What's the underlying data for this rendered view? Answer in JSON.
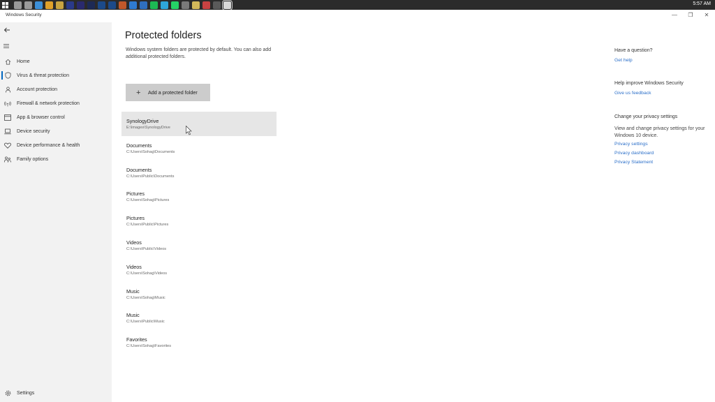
{
  "taskbar": {
    "clock": "5:57 AM",
    "icons": [
      "windows-start-icon",
      "search-icon",
      "task-view-icon",
      "edge-icon",
      "chrome-icon",
      "files-icon",
      "bridge-icon",
      "premiere-icon",
      "media-encoder-icon",
      "photoshop-icon",
      "lightroom-icon",
      "illustrator-icon",
      "mail-icon",
      "onedrive-icon",
      "spotify-icon",
      "telegram-icon",
      "whatsapp-icon",
      "app-icon",
      "notes-icon",
      "app-icon-2",
      "obs-icon",
      "windows-security-icon"
    ]
  },
  "window": {
    "title": "Windows Security",
    "minimize": "—",
    "restore": "❐",
    "close": "✕"
  },
  "sidebar": {
    "items": [
      {
        "label": "Home",
        "icon": "home-icon"
      },
      {
        "label": "Virus & threat protection",
        "icon": "shield-icon"
      },
      {
        "label": "Account protection",
        "icon": "person-icon"
      },
      {
        "label": "Firewall & network protection",
        "icon": "wifi-antenna-icon"
      },
      {
        "label": "App & browser control",
        "icon": "browser-window-icon"
      },
      {
        "label": "Device security",
        "icon": "laptop-icon"
      },
      {
        "label": "Device performance & health",
        "icon": "heart-icon"
      },
      {
        "label": "Family options",
        "icon": "family-icon"
      }
    ],
    "settings_label": "Settings"
  },
  "main": {
    "title": "Protected folders",
    "description": "Windows system folders are protected by default. You can also add additional protected folders.",
    "add_button": "Add a protected folder",
    "folders": [
      {
        "name": "SynologyDrive",
        "path": "E:\\Images\\SynologyDrive"
      },
      {
        "name": "Documents",
        "path": "C:\\Users\\Sohag\\Documents"
      },
      {
        "name": "Documents",
        "path": "C:\\Users\\Public\\Documents"
      },
      {
        "name": "Pictures",
        "path": "C:\\Users\\Sohag\\Pictures"
      },
      {
        "name": "Pictures",
        "path": "C:\\Users\\Public\\Pictures"
      },
      {
        "name": "Videos",
        "path": "C:\\Users\\Public\\Videos"
      },
      {
        "name": "Videos",
        "path": "C:\\Users\\Sohag\\Videos"
      },
      {
        "name": "Music",
        "path": "C:\\Users\\Sohag\\Music"
      },
      {
        "name": "Music",
        "path": "C:\\Users\\Public\\Music"
      },
      {
        "name": "Favorites",
        "path": "C:\\Users\\Sohag\\Favorites"
      }
    ]
  },
  "rail": {
    "question_heading": "Have a question?",
    "get_help": "Get help",
    "improve_heading": "Help improve Windows Security",
    "feedback": "Give us feedback",
    "privacy_heading": "Change your privacy settings",
    "privacy_text": "View and change privacy settings for your Windows 10 device.",
    "privacy_settings": "Privacy settings",
    "privacy_dashboard": "Privacy dashboard",
    "privacy_statement": "Privacy Statement"
  },
  "colors": {
    "accent": "#0067c0",
    "link": "#2b6fc9",
    "sidebar_bg": "#f2f2f2",
    "button_bg": "#cccccc",
    "taskbar_bg": "#2b2b2b"
  }
}
